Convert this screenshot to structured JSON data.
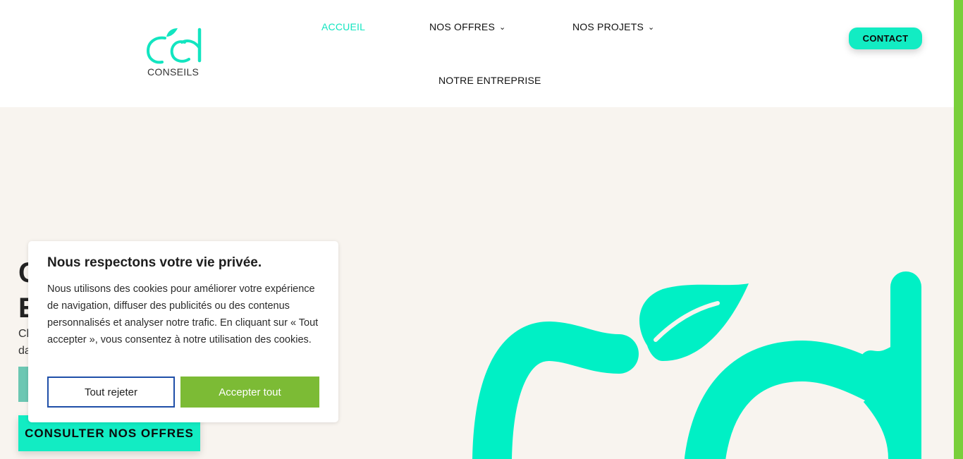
{
  "brand": {
    "logo_text": "CONSEILS"
  },
  "nav": {
    "items": [
      {
        "label": "ACCUEIL",
        "active": true
      },
      {
        "label": "NOS OFFRES",
        "dropdown": true
      },
      {
        "label": "NOS PROJETS",
        "dropdown": true
      },
      {
        "label": "NOTRE ENTREPRISE"
      }
    ],
    "contact_label": "CONTACT"
  },
  "hero": {
    "title_line1": "C",
    "title_line2": "E",
    "subtitle_line1": "Cl",
    "subtitle_line2": "da",
    "cta_label": "CONSULTER NOS OFFRES"
  },
  "cookie": {
    "title": "Nous respectons votre vie privée.",
    "text": "Nous utilisons des cookies pour améliorer votre expérience de navigation, diffuser des publicités ou des contenus personnalisés et analyser notre trafic. En cliquant sur « Tout accepter », vous consentez à notre utilisation des cookies.",
    "reject_label": "Tout rejeter",
    "accept_label": "Accepter tout"
  },
  "colors": {
    "accent": "#12ecc3",
    "accept_green": "#7cbb35",
    "reject_border": "#1f4fa8",
    "hero_bg": "#f8f4ef",
    "scrollbar": "#79cf3a"
  },
  "icons": [
    "chevron-down-icon",
    "logo-apple-icon"
  ]
}
